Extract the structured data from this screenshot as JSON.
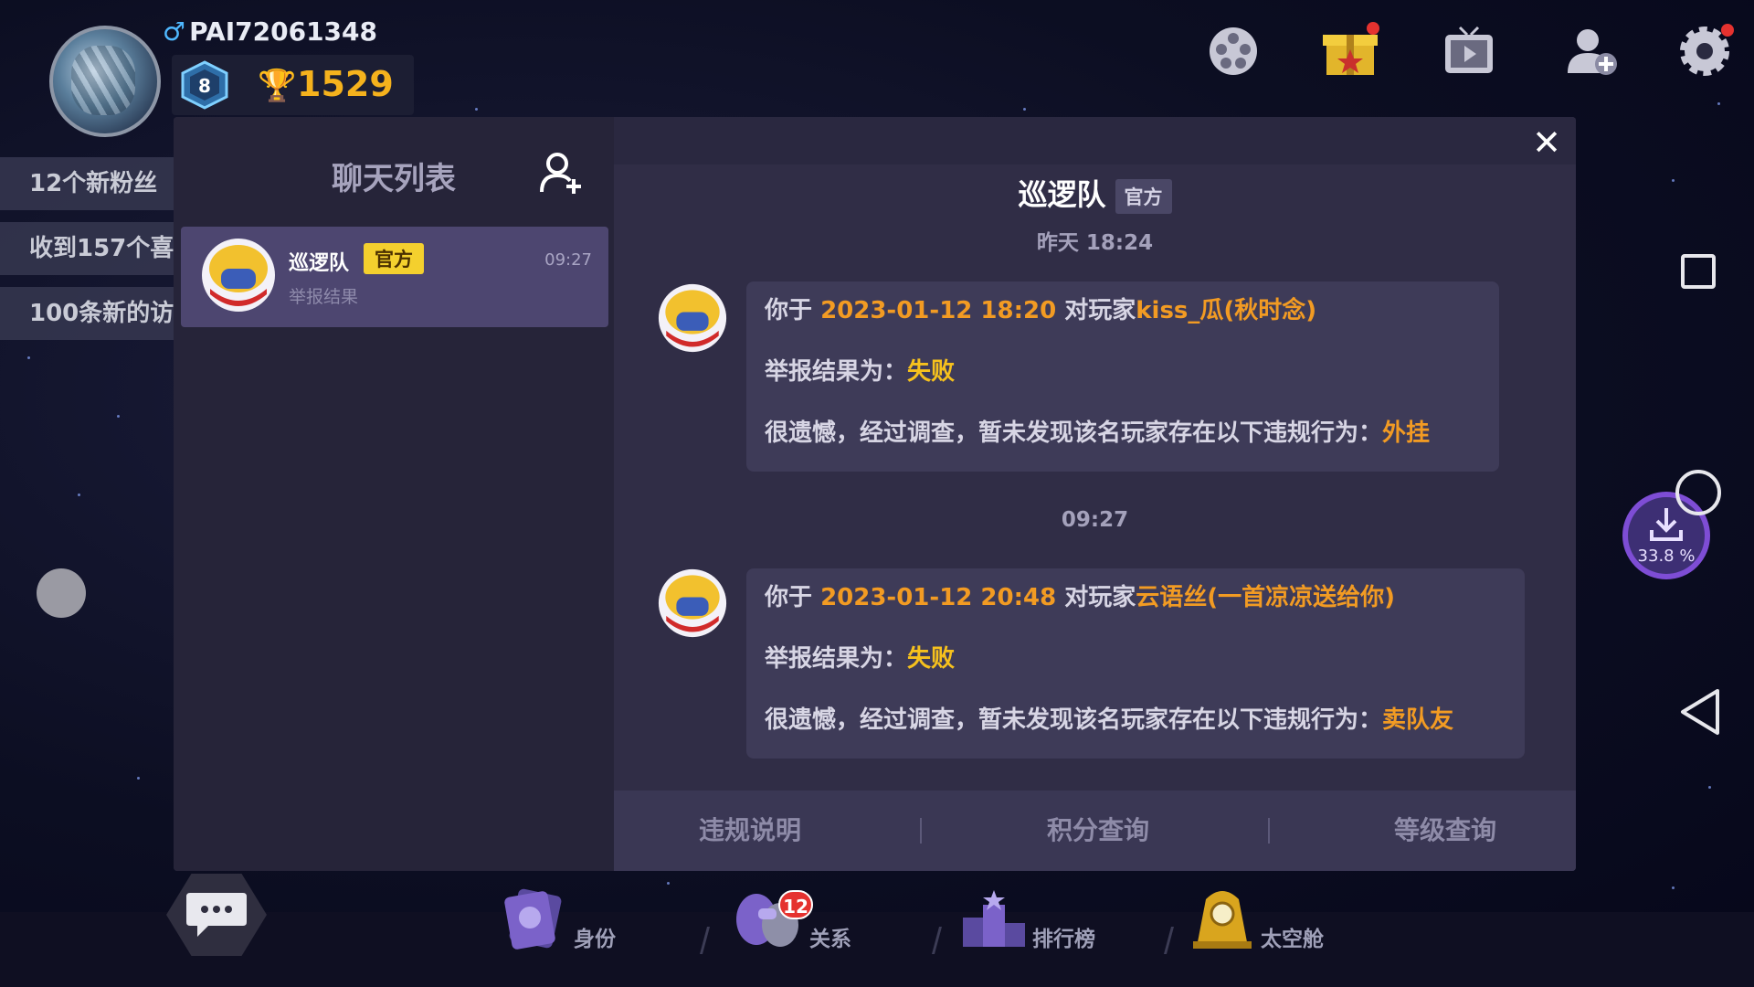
{
  "profile": {
    "username": "PAI72061348",
    "gender_icon": "male-icon",
    "level": "8",
    "trophies": "1529"
  },
  "notifications": [
    {
      "text": "12个新粉丝"
    },
    {
      "text": "收到157个喜"
    },
    {
      "text": "100条新的访"
    }
  ],
  "top_icons": [
    "film-reel-icon",
    "gift-box-icon",
    "tv-video-icon",
    "add-user-icon",
    "settings-gear-icon"
  ],
  "chat_list": {
    "title": "聊天列表",
    "items": [
      {
        "name": "巡逻队",
        "tag": "官方",
        "time": "09:27",
        "preview": "举报结果"
      }
    ]
  },
  "conversation": {
    "title": "巡逻队",
    "tag": "官方",
    "messages": [
      {
        "timestamp": "昨天 18:24",
        "line1_prefix": "你于 ",
        "datetime": "2023-01-12 18:20",
        "line1_mid": " 对玩家",
        "player": "kiss_瓜(秋时念)",
        "line2_prefix": "举报结果为：",
        "result": "失败",
        "line3_prefix": "很遗憾，经过调查，暂未发现该名玩家存在以下违规行为：",
        "violation": "外挂"
      },
      {
        "timestamp": "09:27",
        "line1_prefix": "你于 ",
        "datetime": "2023-01-12 20:48",
        "line1_mid": " 对玩家",
        "player": "云语丝(一首凉凉送给你)",
        "line2_prefix": "举报结果为：",
        "result": "失败",
        "line3_prefix": "很遗憾，经过调查，暂未发现该名玩家存在以下违规行为：",
        "violation": "卖队友"
      }
    ],
    "footer": [
      "违规说明",
      "积分查询",
      "等级查询"
    ]
  },
  "download_badge": {
    "percent": "33.8 %"
  },
  "bottom_nav": {
    "tabs": [
      {
        "label": "身份",
        "icon": "identity-card-icon"
      },
      {
        "label": "关系",
        "icon": "relationship-icon",
        "badge": "12"
      },
      {
        "label": "排行榜",
        "icon": "leaderboard-icon"
      },
      {
        "label": "太空舱",
        "icon": "space-capsule-icon"
      }
    ]
  },
  "colors": {
    "accent_orange": "#f29b23",
    "accent_yellow": "#f6c11d",
    "official_tag": "#f4d02e",
    "modal_bg": "#2e2c44",
    "selected_item": "#4d4670"
  }
}
